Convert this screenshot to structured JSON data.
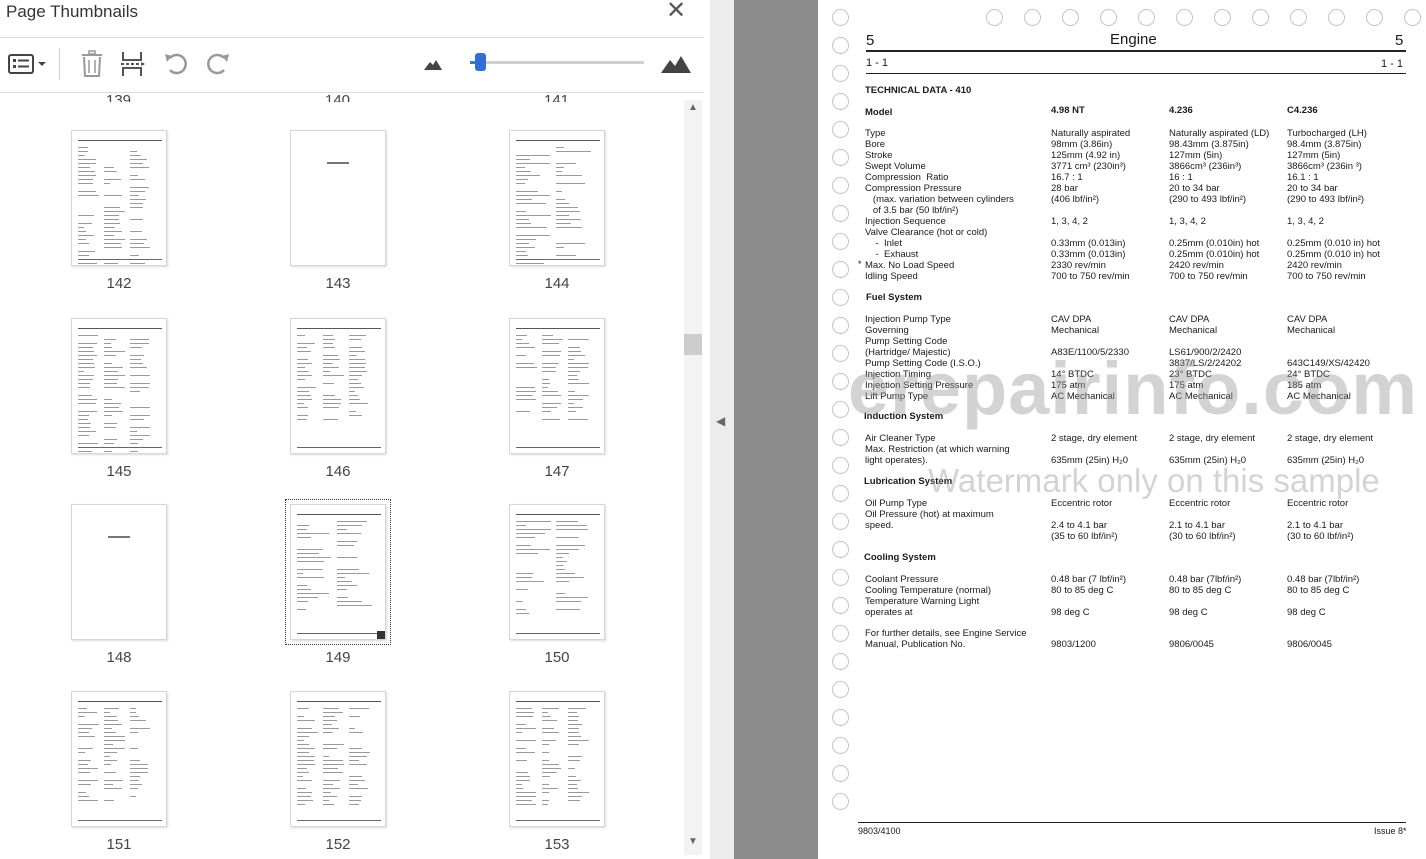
{
  "panel": {
    "title": "Page Thumbnails",
    "zoom_level": 0.03,
    "partial_labels": [
      "139",
      "140",
      "141"
    ],
    "thumbnails": [
      {
        "page": "142"
      },
      {
        "page": "143"
      },
      {
        "page": "144"
      },
      {
        "page": "145"
      },
      {
        "page": "146"
      },
      {
        "page": "147"
      },
      {
        "page": "148"
      },
      {
        "page": "149",
        "selected": true
      },
      {
        "page": "150"
      },
      {
        "page": "151"
      },
      {
        "page": "152"
      },
      {
        "page": "153"
      }
    ],
    "icons": {
      "close": "close-icon",
      "options": "options-menu-icon",
      "delete": "trash-icon",
      "insert": "insert-pages-icon",
      "rotate_ccw": "rotate-counterclockwise-icon",
      "rotate_cw": "rotate-clockwise-icon",
      "zoom_out": "mountain-small-icon",
      "zoom_in": "mountain-large-icon"
    },
    "accent": "#2f6fd6"
  },
  "document": {
    "section_left": "5",
    "section_title": "Engine",
    "section_right": "5",
    "sub_left": "1 - 1",
    "sub_right": "1 - 1",
    "heading": "TECHNICAL DATA - 410",
    "model_label": "Model",
    "models": [
      "4.98 NT",
      "4.236",
      "C4.236"
    ],
    "engine_rows": [
      {
        "label": "Type",
        "v": [
          "Naturally aspirated",
          "Naturally aspirated (LD)",
          "Turbocharged (LH)"
        ]
      },
      {
        "label": "Bore",
        "v": [
          "98mm (3.86in)",
          "98.43mm (3.875in)",
          "98.4mm (3.875in)"
        ]
      },
      {
        "label": "Stroke",
        "v": [
          "125mm (4.92 in)",
          "127mm (5in)",
          "127mm (5in)"
        ]
      },
      {
        "label": "Swept Volume",
        "v": [
          "3771 cm³ (230in³)",
          "3866cm³ (236in³)",
          "3866cm³ (236in ³)"
        ]
      },
      {
        "label": "Compression  Ratio",
        "v": [
          "16.7 : 1",
          "16 : 1",
          "16.1 : 1"
        ]
      },
      {
        "label": "Compression Pressure",
        "v": [
          "28 bar",
          "20 to 34 bar",
          "20 to 34 bar"
        ]
      },
      {
        "label": "   (max. variation between cylinders",
        "v": [
          "(406 lbf/in²)",
          "(290 to 493 lbf/in²)",
          "(290 to 493 lbf/in²)"
        ]
      },
      {
        "label": "   of 3.5 bar (50 lbf/in²)",
        "v": [
          "",
          "",
          ""
        ]
      },
      {
        "label": "Injection Sequence",
        "v": [
          "1, 3, 4, 2",
          "1, 3, 4, 2",
          "1, 3, 4, 2"
        ]
      },
      {
        "label": "Valve Clearance (hot or cold)",
        "v": [
          "",
          "",
          ""
        ]
      },
      {
        "label": "    -  Inlet",
        "v": [
          "0.33mm (0.013in)",
          "0.25mm (0.010in) hot",
          "0.25mm (0.010 in) hot"
        ]
      },
      {
        "label": "    -  Exhaust",
        "v": [
          "0.33mm (0.013in)",
          "0.25mm (0.010in) hot",
          "0.25mm (0.010 in) hot"
        ]
      },
      {
        "label": "Max. No Load Speed",
        "v": [
          "2330 rev/min",
          "2420 rev/min",
          "2420 rev/min"
        ]
      },
      {
        "label": "Idling Speed",
        "v": [
          "700 to 750 rev/min",
          "700 to 750 rev/min",
          "700 to 750 rev/min"
        ]
      }
    ],
    "fuel_heading": "Fuel System",
    "fuel_rows": [
      {
        "label": "Injection Pump Type",
        "v": [
          "CAV DPA",
          "CAV DPA",
          "CAV DPA"
        ]
      },
      {
        "label": "Governing",
        "v": [
          "Mechanical",
          "Mechanical",
          "Mechanical"
        ]
      },
      {
        "label": "Pump Setting Code",
        "v": [
          "",
          "",
          ""
        ]
      },
      {
        "label": "(Hartridge/ Majestic)",
        "v": [
          "A83E/1100/5/2330",
          "LS61/900/2/2420",
          ""
        ]
      },
      {
        "label": "Pump Setting Code (I.S.O.)",
        "v": [
          "",
          "3837/LS/2/24202",
          "643C149/XS/42420"
        ]
      },
      {
        "label": "Injection Timing",
        "v": [
          "14° BTDC",
          "23° BTDC",
          "24° BTDC"
        ]
      },
      {
        "label": "Injection Setting Pressure",
        "v": [
          "175 atm",
          "175 atm",
          "185 atm"
        ]
      },
      {
        "label": "Lift Pump Type",
        "v": [
          "AC Mechanical",
          "AC Mechanical",
          "AC Mechanical"
        ]
      }
    ],
    "induction_heading": "Induction System",
    "induction_rows": [
      {
        "label": "Air Cleaner Type",
        "v": [
          "2 stage, dry element",
          "2 stage, dry element",
          "2 stage, dry element"
        ]
      },
      {
        "label": "Max. Restriction (at which warning",
        "v": [
          "",
          "",
          ""
        ]
      },
      {
        "label": "light operates).",
        "v": [
          "635mm (25in) H₂0",
          "635mm (25in) H₂0",
          "635mm (25in) H₂0"
        ]
      }
    ],
    "lube_heading": "Lubrication System",
    "lube_rows": [
      {
        "label": "Oil Pump Type",
        "v": [
          "Eccentric rotor",
          "Eccentric rotor",
          "Eccentric rotor"
        ]
      },
      {
        "label": "Oil Pressure (hot) at maximum",
        "v": [
          "",
          "",
          ""
        ]
      },
      {
        "label": "speed.",
        "v": [
          "2.4 to 4.1 bar",
          "2.1 to 4.1 bar",
          "2.1 to 4.1 bar"
        ]
      },
      {
        "label": "",
        "v": [
          "(35 to 60 lbf/in²)",
          "(30 to 60 lbf/in²)",
          "(30 to 60 lbf/in²)"
        ]
      }
    ],
    "cooling_heading": "Cooling System",
    "cooling_rows": [
      {
        "label": "Coolant Pressure",
        "v": [
          "0.48 bar (7 lbf/in²)",
          "0.48 bar (7lbf/in²)",
          "0.48 bar (7lbf/in²)"
        ]
      },
      {
        "label": "Cooling Temperature (normal)",
        "v": [
          "80 to 85 deg C",
          "80 to 85 deg C",
          "80 to 85 deg C"
        ]
      },
      {
        "label": "Temperature Warning Light",
        "v": [
          "",
          "",
          ""
        ]
      },
      {
        "label": "operates at",
        "v": [
          "98 deg C",
          "98 deg C",
          "98 deg C"
        ]
      }
    ],
    "further_rows": [
      {
        "label": "For further details, see Engine Service",
        "v": [
          "",
          "",
          ""
        ]
      },
      {
        "label": "Manual, Publication No.",
        "v": [
          "9803/1200",
          "9806/0045",
          "9806/0045"
        ]
      }
    ],
    "footer_left": "9803/4100",
    "footer_right": "Issue 8*",
    "watermark": "erepairinfo.com",
    "watermark_note": "Watermark only on this sample"
  }
}
